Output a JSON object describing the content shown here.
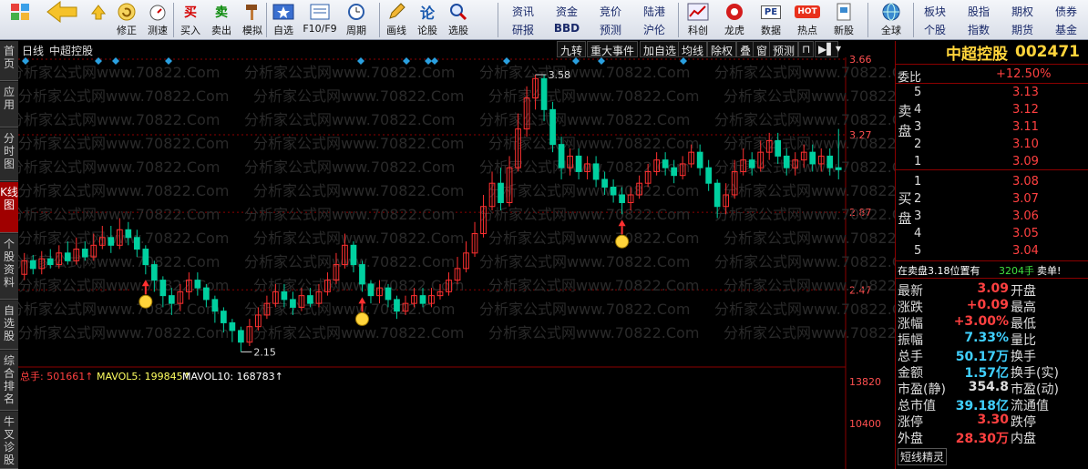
{
  "toolbar": {
    "icons": [
      "grid-icon",
      "arrow-left-icon",
      "arrow-up-icon",
      "arrow-down-icon",
      "stopwatch-icon",
      "clock-icon",
      "buy-icon",
      "sell-icon",
      "hammer-icon"
    ],
    "buttons": [
      {
        "name": "modify-button",
        "label": "修正"
      },
      {
        "name": "speedtest-button",
        "label": "测速"
      },
      {
        "name": "buy-button",
        "label": "买入",
        "glyph": "买"
      },
      {
        "name": "sell-button",
        "label": "卖出",
        "glyph": "卖"
      },
      {
        "name": "simulate-button",
        "label": "模拟"
      },
      {
        "name": "watchlist-button",
        "label": "自选"
      },
      {
        "name": "f10-button",
        "label": "F10/F9"
      },
      {
        "name": "period-button",
        "label": "周期"
      },
      {
        "name": "draw-button",
        "label": "画线"
      },
      {
        "name": "comment-button",
        "label": "论股"
      },
      {
        "name": "select-button",
        "label": "选股"
      },
      {
        "name": "kechuang-button",
        "label": "科创"
      },
      {
        "name": "dragon-button",
        "label": "龙虎"
      },
      {
        "name": "data-button",
        "label": "数据",
        "glyph": "PE"
      },
      {
        "name": "hot-button",
        "label": "热点",
        "glyph": "HOT"
      },
      {
        "name": "newstock-button",
        "label": "新股"
      },
      {
        "name": "global-button",
        "label": "全球"
      }
    ],
    "text_buttons": [
      {
        "name": "news-button",
        "label": "资讯"
      },
      {
        "name": "fund-button",
        "label": "资金"
      },
      {
        "name": "auction-button",
        "label": "竞价"
      },
      {
        "name": "lugang-button",
        "label": "陆港"
      },
      {
        "name": "research-button",
        "label": "研报"
      },
      {
        "name": "bbd-button",
        "label": "BBD"
      },
      {
        "name": "forecast-button",
        "label": "预测"
      },
      {
        "name": "hugang-button",
        "label": "沪伦"
      },
      {
        "name": "sector-button",
        "label": "板块"
      },
      {
        "name": "stock-index-button",
        "label": "股指"
      },
      {
        "name": "futures-button",
        "label": "期权"
      },
      {
        "name": "bond-button",
        "label": "债券"
      },
      {
        "name": "single-stock-button",
        "label": "个股"
      },
      {
        "name": "index-button",
        "label": "指数"
      },
      {
        "name": "futures2-button",
        "label": "期货"
      },
      {
        "name": "fund2-button",
        "label": "基金"
      }
    ]
  },
  "left_tabs": [
    {
      "name": "tab-home",
      "label": "首页"
    },
    {
      "name": "tab-apps",
      "label": "应用"
    },
    {
      "name": "tab-timeshare",
      "label": "分时图"
    },
    {
      "name": "tab-kline",
      "label": "K线图",
      "active": true
    },
    {
      "name": "tab-f10",
      "label": "个股资料"
    },
    {
      "name": "tab-watchlist",
      "label": "自选股"
    },
    {
      "name": "tab-rank",
      "label": "综合排名"
    },
    {
      "name": "tab-niucha",
      "label": "牛叉诊股"
    }
  ],
  "chart_header": {
    "period": "日线",
    "stock_name": "中超控股",
    "buttons": [
      {
        "name": "jiuzhuan-button",
        "label": "九转"
      },
      {
        "name": "major-events-button",
        "label": "重大事件"
      },
      {
        "name": "add-watchlist-button",
        "label": "加自选"
      },
      {
        "name": "ma-button",
        "label": "均线"
      },
      {
        "name": "exright-button",
        "label": "除权"
      },
      {
        "name": "overlay-button",
        "label": "叠"
      },
      {
        "name": "window-button",
        "label": "窗"
      },
      {
        "name": "forecast-chart-button",
        "label": "预测"
      }
    ]
  },
  "watermark": "分析家公式网www.70822.Com",
  "volume_legend": {
    "total": "总手: 501661↑",
    "mavol5": "MAVOL5: 199845↑",
    "mavol10": "MAVOL10: 168783↑"
  },
  "annotations": {
    "high": "3.58",
    "low": "2.15"
  },
  "chart_data": [
    {
      "type": "candlestick",
      "title": "中超控股",
      "ylabel": "",
      "y_ticks": [
        "3.66",
        "3.27",
        "2.87",
        "2.47"
      ],
      "ylim": [
        2.1,
        3.66
      ],
      "high_marker": 3.58,
      "low_marker": 2.15,
      "candles": [
        [
          2.55,
          2.62,
          2.66,
          2.52
        ],
        [
          2.62,
          2.58,
          2.65,
          2.55
        ],
        [
          2.58,
          2.63,
          2.67,
          2.55
        ],
        [
          2.63,
          2.6,
          2.68,
          2.58
        ],
        [
          2.6,
          2.66,
          2.7,
          2.58
        ],
        [
          2.66,
          2.62,
          2.72,
          2.6
        ],
        [
          2.62,
          2.68,
          2.74,
          2.6
        ],
        [
          2.68,
          2.64,
          2.72,
          2.62
        ],
        [
          2.64,
          2.7,
          2.76,
          2.62
        ],
        [
          2.7,
          2.74,
          2.8,
          2.68
        ],
        [
          2.74,
          2.7,
          2.8,
          2.66
        ],
        [
          2.7,
          2.78,
          2.84,
          2.68
        ],
        [
          2.78,
          2.74,
          2.82,
          2.7
        ],
        [
          2.74,
          2.68,
          2.78,
          2.64
        ],
        [
          2.68,
          2.6,
          2.7,
          2.55
        ],
        [
          2.6,
          2.52,
          2.62,
          2.46
        ],
        [
          2.52,
          2.44,
          2.54,
          2.38
        ],
        [
          2.44,
          2.4,
          2.48,
          2.34
        ],
        [
          2.4,
          2.46,
          2.5,
          2.36
        ],
        [
          2.46,
          2.52,
          2.56,
          2.42
        ],
        [
          2.52,
          2.48,
          2.56,
          2.44
        ],
        [
          2.48,
          2.42,
          2.5,
          2.38
        ],
        [
          2.42,
          2.36,
          2.44,
          2.3
        ],
        [
          2.36,
          2.3,
          2.38,
          2.25
        ],
        [
          2.3,
          2.26,
          2.32,
          2.2
        ],
        [
          2.26,
          2.2,
          2.28,
          2.15
        ],
        [
          2.2,
          2.28,
          2.32,
          2.18
        ],
        [
          2.28,
          2.34,
          2.38,
          2.26
        ],
        [
          2.34,
          2.4,
          2.44,
          2.32
        ],
        [
          2.4,
          2.46,
          2.5,
          2.38
        ],
        [
          2.46,
          2.42,
          2.5,
          2.38
        ],
        [
          2.42,
          2.38,
          2.46,
          2.34
        ],
        [
          2.38,
          2.44,
          2.48,
          2.36
        ],
        [
          2.44,
          2.4,
          2.48,
          2.38
        ],
        [
          2.4,
          2.46,
          2.5,
          2.38
        ],
        [
          2.46,
          2.52,
          2.56,
          2.44
        ],
        [
          2.52,
          2.6,
          2.66,
          2.5
        ],
        [
          2.6,
          2.7,
          2.76,
          2.58
        ],
        [
          2.7,
          2.6,
          2.72,
          2.56
        ],
        [
          2.6,
          2.5,
          2.62,
          2.46
        ],
        [
          2.5,
          2.44,
          2.52,
          2.4
        ],
        [
          2.44,
          2.48,
          2.52,
          2.4
        ],
        [
          2.48,
          2.42,
          2.5,
          2.38
        ],
        [
          2.42,
          2.36,
          2.44,
          2.32
        ],
        [
          2.36,
          2.4,
          2.44,
          2.34
        ],
        [
          2.4,
          2.44,
          2.48,
          2.38
        ],
        [
          2.44,
          2.4,
          2.48,
          2.38
        ],
        [
          2.4,
          2.44,
          2.48,
          2.38
        ],
        [
          2.44,
          2.46,
          2.5,
          2.42
        ],
        [
          2.46,
          2.52,
          2.56,
          2.44
        ],
        [
          2.52,
          2.58,
          2.64,
          2.5
        ],
        [
          2.58,
          2.66,
          2.72,
          2.56
        ],
        [
          2.66,
          2.76,
          2.82,
          2.64
        ],
        [
          2.76,
          2.9,
          2.96,
          2.74
        ],
        [
          2.9,
          3.02,
          3.08,
          2.88
        ],
        [
          3.02,
          2.92,
          3.1,
          2.88
        ],
        [
          2.92,
          3.1,
          3.16,
          2.9
        ],
        [
          3.1,
          3.3,
          3.38,
          3.08
        ],
        [
          3.3,
          3.46,
          3.52,
          3.26
        ],
        [
          3.46,
          3.56,
          3.58,
          3.4
        ],
        [
          3.56,
          3.4,
          3.58,
          3.34
        ],
        [
          3.4,
          3.22,
          3.44,
          3.18
        ],
        [
          3.22,
          3.1,
          3.26,
          3.04
        ],
        [
          3.1,
          3.16,
          3.2,
          3.06
        ],
        [
          3.16,
          3.08,
          3.2,
          3.04
        ],
        [
          3.08,
          3.12,
          3.16,
          3.04
        ],
        [
          3.12,
          3.04,
          3.16,
          3.0
        ],
        [
          3.04,
          3.0,
          3.08,
          2.96
        ],
        [
          3.0,
          2.96,
          3.04,
          2.92
        ],
        [
          2.96,
          2.92,
          3.0,
          2.86
        ],
        [
          2.92,
          2.96,
          3.0,
          2.88
        ],
        [
          2.96,
          3.02,
          3.06,
          2.94
        ],
        [
          3.02,
          3.08,
          3.12,
          3.0
        ],
        [
          3.08,
          3.14,
          3.18,
          3.06
        ],
        [
          3.14,
          3.1,
          3.18,
          3.06
        ],
        [
          3.1,
          3.06,
          3.14,
          3.02
        ],
        [
          3.06,
          3.12,
          3.16,
          3.04
        ],
        [
          3.12,
          3.18,
          3.22,
          3.1
        ],
        [
          3.18,
          3.1,
          3.22,
          3.06
        ],
        [
          3.1,
          3.02,
          3.14,
          2.98
        ],
        [
          3.02,
          2.9,
          3.04,
          2.84
        ],
        [
          2.9,
          2.96,
          3.02,
          2.86
        ],
        [
          2.96,
          3.08,
          3.14,
          2.94
        ],
        [
          3.08,
          3.14,
          3.2,
          3.06
        ],
        [
          3.14,
          3.1,
          3.18,
          3.06
        ],
        [
          3.1,
          3.18,
          3.24,
          3.08
        ],
        [
          3.18,
          3.24,
          3.28,
          3.14
        ],
        [
          3.24,
          3.16,
          3.28,
          3.12
        ],
        [
          3.16,
          3.1,
          3.2,
          3.06
        ],
        [
          3.1,
          3.14,
          3.18,
          3.06
        ],
        [
          3.14,
          3.18,
          3.22,
          3.1
        ],
        [
          3.18,
          3.12,
          3.22,
          3.08
        ],
        [
          3.12,
          3.16,
          3.2,
          3.08
        ],
        [
          3.16,
          3.1,
          3.2,
          3.06
        ],
        [
          3.1,
          3.09,
          3.3,
          3.04
        ]
      ],
      "volume_ticks": [
        "13820",
        "10400"
      ]
    }
  ],
  "quote_panel": {
    "name": "中超控股",
    "code": "002471",
    "weibi_label": "委比",
    "weibi_value": "+12.50%",
    "sell_label": "卖盘",
    "buy_label": "买盘",
    "sell": [
      {
        "level": "5",
        "price": "3.13"
      },
      {
        "level": "4",
        "price": "3.12"
      },
      {
        "level": "3",
        "price": "3.11"
      },
      {
        "level": "2",
        "price": "3.10"
      },
      {
        "level": "1",
        "price": "3.09"
      }
    ],
    "buy": [
      {
        "level": "1",
        "price": "3.08"
      },
      {
        "level": "2",
        "price": "3.07"
      },
      {
        "level": "3",
        "price": "3.06"
      },
      {
        "level": "4",
        "price": "3.05"
      },
      {
        "level": "5",
        "price": "3.04"
      }
    ],
    "notice_prefix": "在卖盘3.18位置有",
    "notice_qty": "3204手",
    "notice_suffix": "卖单!",
    "stats": [
      {
        "label": "最新",
        "value": "3.09",
        "value_color": "#ff4040",
        "label2": "开盘"
      },
      {
        "label": "涨跌",
        "value": "+0.09",
        "value_color": "#ff4040",
        "label2": "最高"
      },
      {
        "label": "涨幅",
        "value": "+3.00%",
        "value_color": "#ff4040",
        "label2": "最低"
      },
      {
        "label": "振幅",
        "value": "7.33%",
        "value_color": "#40d0ff",
        "label2": "量比"
      },
      {
        "label": "总手",
        "value": "50.17万",
        "value_color": "#40d0ff",
        "label2": "换手"
      },
      {
        "label": "金额",
        "value": "1.57亿",
        "value_color": "#40d0ff",
        "label2": "换手(实)"
      },
      {
        "label": "市盈(静)",
        "value": "354.8",
        "value_color": "#dddddd",
        "label2": "市盈(动)"
      },
      {
        "label": "总市值",
        "value": "39.18亿",
        "value_color": "#40d0ff",
        "label2": "流通值"
      },
      {
        "label": "涨停",
        "value": "3.30",
        "value_color": "#ff4040",
        "label2": "跌停"
      },
      {
        "label": "外盘",
        "value": "28.30万",
        "value_color": "#ff4040",
        "label2": "内盘"
      }
    ],
    "footer": "短线精灵"
  },
  "colors": {
    "up": "#ff3030",
    "down": "#00d0a0",
    "grid": "#8b0000",
    "accent": "#ffd43b",
    "cyan": "#40d0ff",
    "ma5": "#ffffff",
    "ma10": "#ffff60"
  }
}
